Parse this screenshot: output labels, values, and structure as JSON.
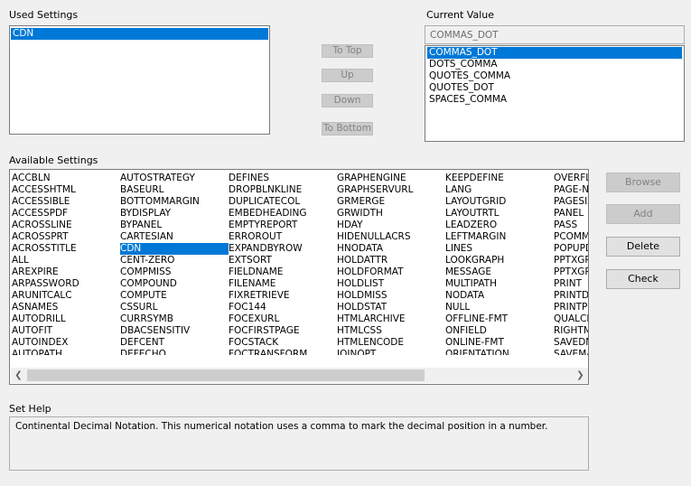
{
  "used_settings": {
    "label": "Used Settings",
    "items": [
      "CDN"
    ]
  },
  "current_value": {
    "label": "Current Value",
    "value": "COMMAS_DOT",
    "options": [
      "COMMAS_DOT",
      "DOTS_COMMA",
      "QUOTES_COMMA",
      "QUOTES_DOT",
      "SPACES_COMMA"
    ]
  },
  "order_buttons": {
    "to_top": "To Top",
    "up": "Up",
    "down": "Down",
    "to_bottom": "To Bottom"
  },
  "available_settings": {
    "label": "Available Settings",
    "selected": "CDN",
    "columns": [
      [
        "ACCBLN",
        "ACCESSHTML",
        "ACCESSIBLE",
        "ACCESSPDF",
        "ACROSSLINE",
        "ACROSSPRT",
        "ACROSSTITLE",
        "ALL",
        "AREXPIRE",
        "ARPASSWORD",
        "ARUNITCALC",
        "ASNAMES",
        "AUTODRILL",
        "AUTOFIT",
        "AUTOINDEX",
        "AUTOPATH"
      ],
      [
        "AUTOSTRATEGY",
        "BASEURL",
        "BOTTOMMARGIN",
        "BYDISPLAY",
        "BYPANEL",
        "CARTESIAN",
        "CDN",
        "CENT-ZERO",
        "COMPMISS",
        "COMPOUND",
        "COMPUTE",
        "CSSURL",
        "CURRSYMB",
        "DBACSENSITIV",
        "DEFCENT",
        "DEFECHO"
      ],
      [
        "DEFINES",
        "DROPBLNKLINE",
        "DUPLICATECOL",
        "EMBEDHEADING",
        "EMPTYREPORT",
        "ERROROUT",
        "EXPANDBYROW",
        "EXTSORT",
        "FIELDNAME",
        "FILENAME",
        "FIXRETRIEVE",
        "FOC144",
        "FOCEXURL",
        "FOCFIRSTPAGE",
        "FOCSTACK",
        "FOCTRANSFORM"
      ],
      [
        "GRAPHENGINE",
        "GRAPHSERVURL",
        "GRMERGE",
        "GRWIDTH",
        "HDAY",
        "HIDENULLACRS",
        "HNODATA",
        "HOLDATTR",
        "HOLDFORMAT",
        "HOLDLIST",
        "HOLDMISS",
        "HOLDSTAT",
        "HTMLARCHIVE",
        "HTMLCSS",
        "HTMLENCODE",
        "JOINOPT"
      ],
      [
        "KEEPDEFINE",
        "LANG",
        "LAYOUTGRID",
        "LAYOUTRTL",
        "LEADZERO",
        "LEFTMARGIN",
        "LINES",
        "LOOKGRAPH",
        "MESSAGE",
        "MULTIPATH",
        "NODATA",
        "NULL",
        "OFFLINE-FMT",
        "ONFIELD",
        "ONLINE-FMT",
        "ORIENTATION"
      ],
      [
        "OVERFL",
        "PAGE-NU",
        "PAGESIZ",
        "PANEL",
        "PASS",
        "PCOMMA",
        "POPUPD",
        "PPTXGR",
        "PPTXGR",
        "PRINT",
        "PRINTDS",
        "PRINTPL",
        "QUALCH",
        "RIGHTM",
        "SAVEDM",
        "SAVEMA"
      ]
    ]
  },
  "side_buttons": {
    "browse": "Browse",
    "add": "Add",
    "delete": "Delete",
    "check": "Check"
  },
  "set_help": {
    "label": "Set Help",
    "text": "Continental Decimal Notation. This numerical notation uses a comma to mark the decimal position in a number."
  },
  "icons": {
    "scroll_left": "chevron-left-icon",
    "scroll_right": "chevron-right-icon"
  },
  "colors": {
    "selection": "#0078d7",
    "window_bg": "#f0f0f0"
  }
}
